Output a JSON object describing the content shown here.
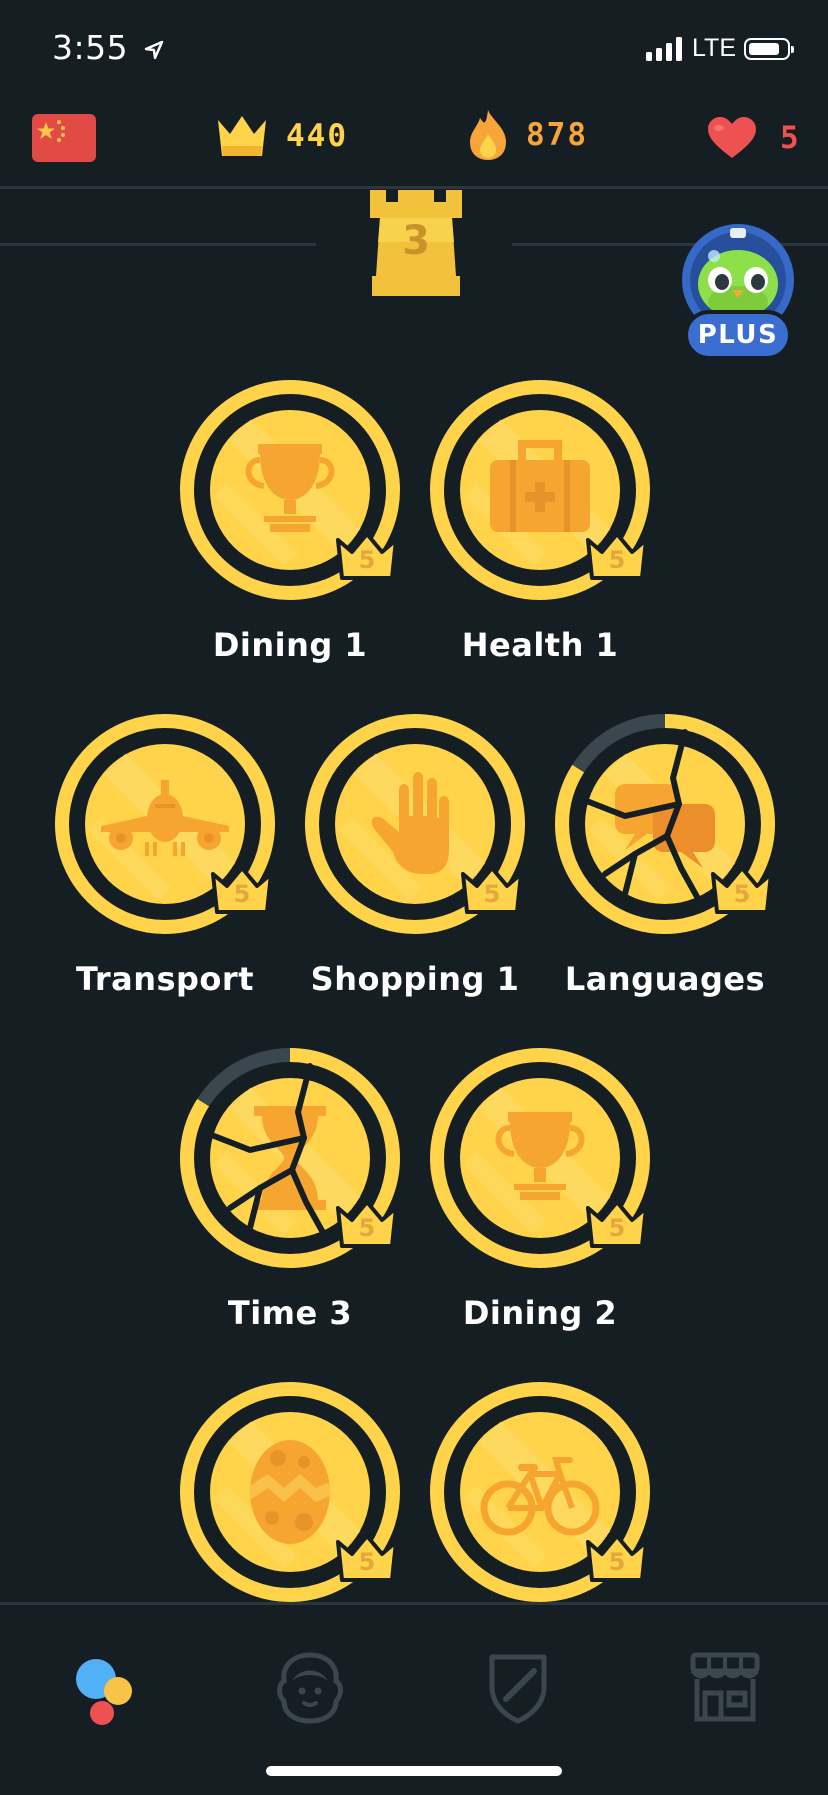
{
  "status_bar": {
    "time": "3:55",
    "network": "LTE"
  },
  "header": {
    "course_flag": "china-flag-icon",
    "crowns": "440",
    "streak": "878",
    "hearts": "5"
  },
  "checkpoint": {
    "level": "3"
  },
  "plus_badge": {
    "label": "PLUS"
  },
  "skills": [
    {
      "name": "Dining 1",
      "icon": "trophy-cup-icon",
      "crown_level": "5",
      "cracked": false
    },
    {
      "name": "Health 1",
      "icon": "first-aid-kit-icon",
      "crown_level": "5",
      "cracked": false
    },
    {
      "name": "Transport",
      "icon": "airplane-icon",
      "crown_level": "5",
      "cracked": false
    },
    {
      "name": "Shopping 1",
      "icon": "glove-icon",
      "crown_level": "5",
      "cracked": false
    },
    {
      "name": "Languages",
      "icon": "speech-bubbles-icon",
      "crown_level": "5",
      "cracked": true
    },
    {
      "name": "Time 3",
      "icon": "hourglass-icon",
      "crown_level": "5",
      "cracked": true
    },
    {
      "name": "Dining 2",
      "icon": "trophy-cup-icon",
      "crown_level": "5",
      "cracked": false
    },
    {
      "name": "",
      "icon": "easter-egg-icon",
      "crown_level": "5",
      "cracked": false
    },
    {
      "name": "",
      "icon": "bicycle-icon",
      "crown_level": "5",
      "cracked": false
    }
  ],
  "bottom_nav": {
    "tabs": [
      "learn-tab",
      "profile-tab",
      "leaderboard-tab",
      "shop-tab"
    ]
  },
  "colors": {
    "background": "#151e23",
    "gold": "#ffd44a",
    "gold_dark": "#f5b93a",
    "orange_icon": "#f6a630",
    "crown_text": "#ffd44a",
    "streak": "#f7a43a",
    "heart": "#ee5151",
    "plus_blue": "#3c6ed1"
  }
}
